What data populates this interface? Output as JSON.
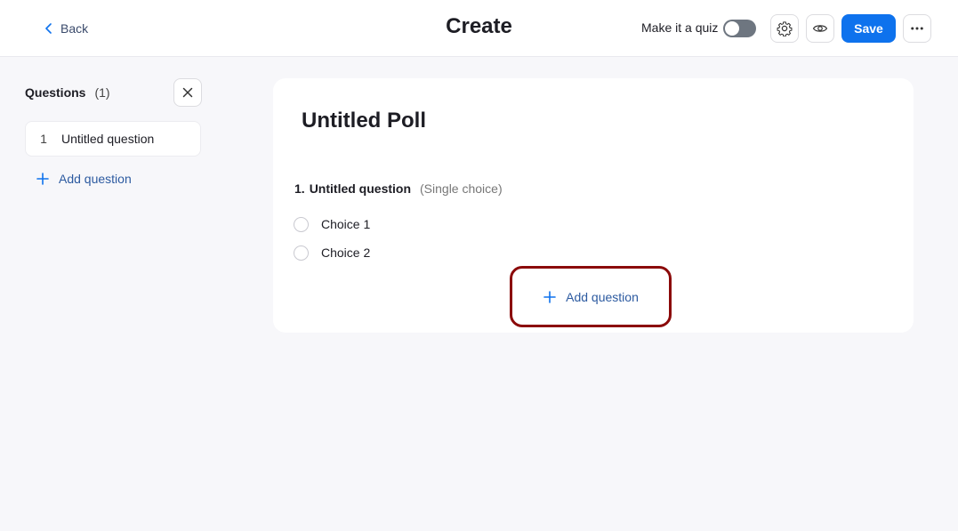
{
  "header": {
    "back_label": "Back",
    "title": "Create",
    "quiz_label": "Make it a quiz",
    "quiz_enabled": false,
    "save_label": "Save"
  },
  "sidebar": {
    "title": "Questions",
    "count": "(1)",
    "items": [
      {
        "number": "1",
        "label": "Untitled question"
      }
    ],
    "add_label": "Add question"
  },
  "main": {
    "poll_title": "Untitled Poll",
    "questions": [
      {
        "number": "1.",
        "title": "Untitled question",
        "type": "(Single choice)",
        "choices": [
          "Choice 1",
          "Choice 2"
        ]
      }
    ],
    "add_label": "Add question"
  },
  "icons": {
    "back": "chevron-left-icon",
    "settings": "gear-icon",
    "preview": "eye-icon",
    "more": "more-horizontal-icon",
    "close": "close-icon",
    "add": "plus-icon"
  },
  "colors": {
    "accent": "#0e72ed",
    "highlight_border": "#8b0a0a",
    "toggle_off": "#6e7680"
  }
}
